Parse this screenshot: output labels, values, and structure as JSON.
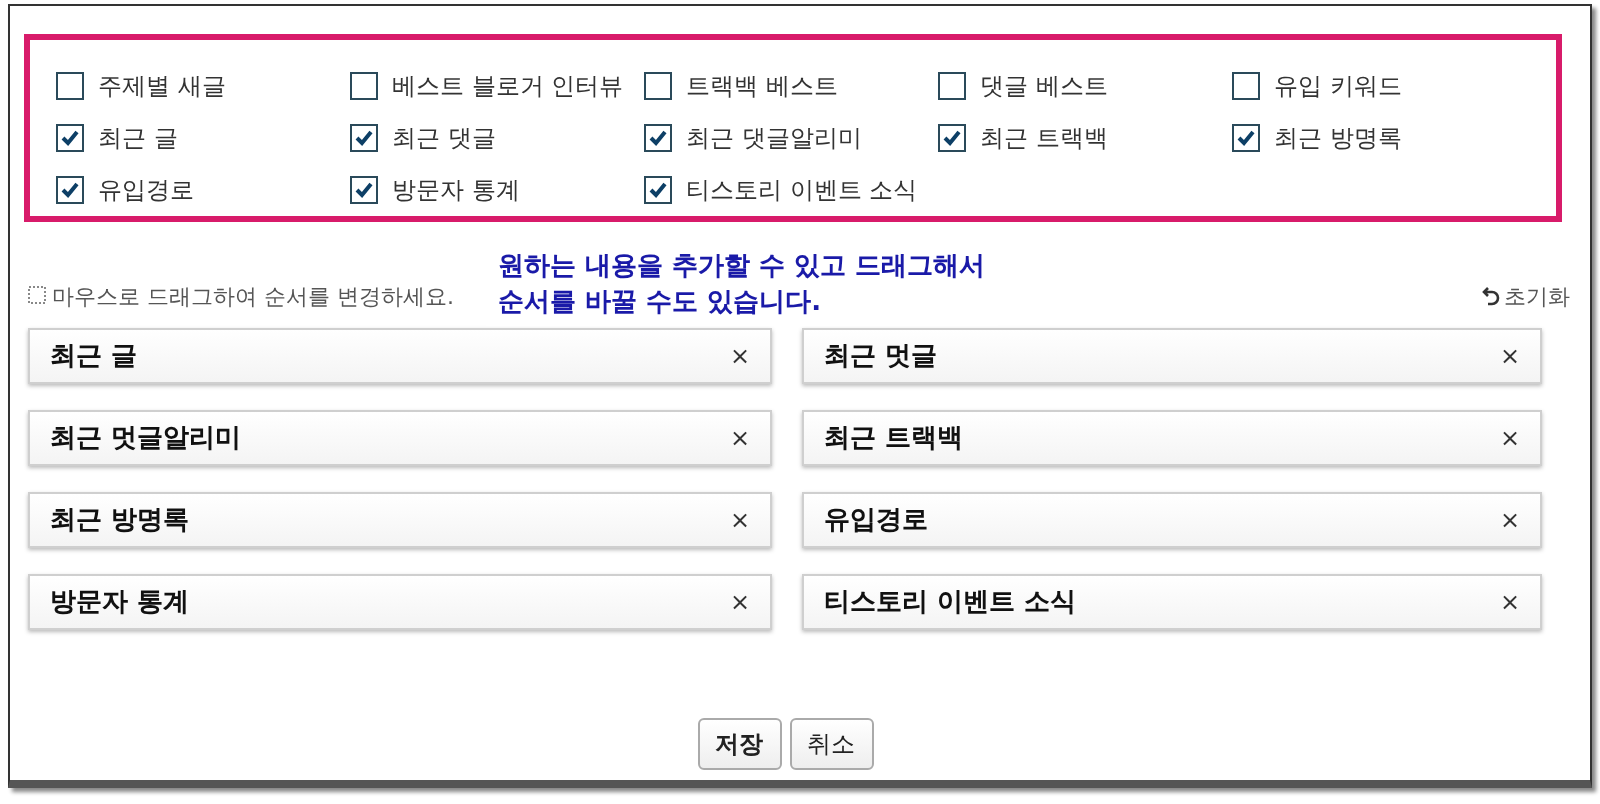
{
  "options": [
    {
      "label": "주제별 새글",
      "checked": false
    },
    {
      "label": "베스트 블로거 인터뷰",
      "checked": false
    },
    {
      "label": "트랙백 베스트",
      "checked": false
    },
    {
      "label": "댓글 베스트",
      "checked": false
    },
    {
      "label": "유입 키워드",
      "checked": false
    },
    {
      "label": "최근 글",
      "checked": true
    },
    {
      "label": "최근 댓글",
      "checked": true
    },
    {
      "label": "최근 댓글알리미",
      "checked": true
    },
    {
      "label": "최근 트랙백",
      "checked": true
    },
    {
      "label": "최근 방명록",
      "checked": true
    },
    {
      "label": "유입경로",
      "checked": true
    },
    {
      "label": "방문자 통계",
      "checked": true
    },
    {
      "label": "티스토리 이벤트 소식",
      "checked": true
    }
  ],
  "hint": "마우스로 드래그하여 순서를 변경하세요.",
  "reset": "초기화",
  "callout_lines": [
    "원하는 내용을 추가할 수 있고 드래그해서",
    "순서를 바꿀 수도 있습니다."
  ],
  "blocks": [
    {
      "label": "최근 글",
      "remove": "×"
    },
    {
      "label": "최근 멋글",
      "remove": "×"
    },
    {
      "label": "최근 멋글알리미",
      "remove": "×"
    },
    {
      "label": "최근 트랙백",
      "remove": "×"
    },
    {
      "label": "최근 방명록",
      "remove": "×"
    },
    {
      "label": "유입경로",
      "remove": "×"
    },
    {
      "label": "방문자 통계",
      "remove": "×"
    },
    {
      "label": "티스토리 이벤트 소식",
      "remove": "×"
    }
  ],
  "buttons": [
    {
      "label": "저장",
      "kind": "primary"
    },
    {
      "label": "취소",
      "kind": "secondary"
    }
  ]
}
